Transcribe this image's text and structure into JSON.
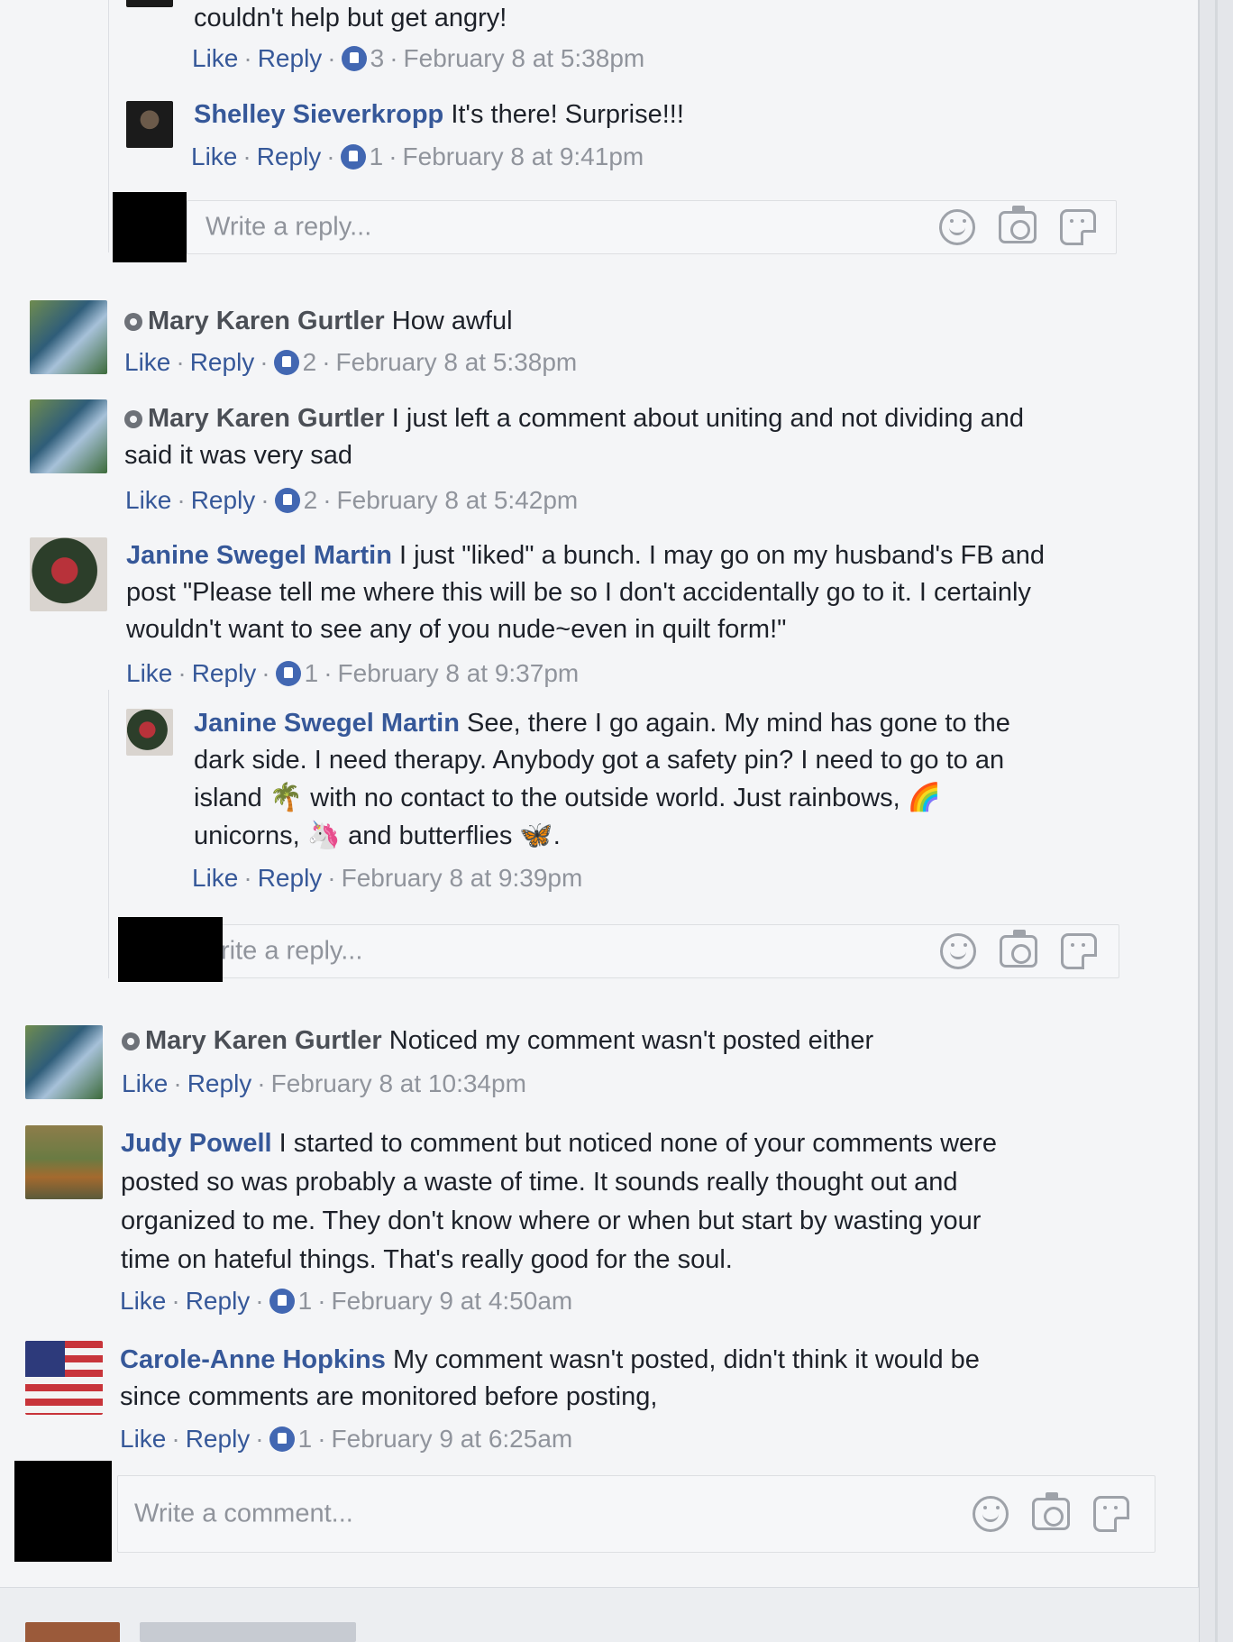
{
  "labels": {
    "like": "Like",
    "reply": "Reply",
    "dot": "·"
  },
  "comments": {
    "c0": {
      "text": "couldn't help but get angry!",
      "likes": "3",
      "time": "February 8 at 5:38pm"
    },
    "c1": {
      "author": "Shelley Sieverkropp",
      "text": "It's there! Surprise!!!",
      "likes": "1",
      "time": "February 8 at 9:41pm"
    },
    "c2": {
      "author": "Mary Karen Gurtler",
      "text": "How awful",
      "likes": "2",
      "time": "February 8 at 5:38pm"
    },
    "c3": {
      "author": "Mary Karen Gurtler",
      "text_line1": "I just left a comment about uniting and not dividing and",
      "text_line2": "said it was very sad",
      "likes": "2",
      "time": "February 8 at 5:42pm"
    },
    "c4": {
      "author": "Janine Swegel Martin",
      "text_line1": "I just \"liked\" a bunch. I may go on my husband's FB and",
      "text_line2": "post \"Please tell me where this will be so I don't accidentally go to it. I certainly",
      "text_line3": "wouldn't want to see any of you nude~even in quilt form!\"",
      "likes": "1",
      "time": "February 8 at 9:37pm"
    },
    "c5": {
      "author": "Janine Swegel Martin",
      "text_line1": "See, there I go again. My mind has gone to the",
      "text_line2": "dark side. I need therapy. Anybody got a safety pin? I need to go to an",
      "text_line3a": "island",
      "text_line3b": "with no contact to the outside world. Just rainbows,",
      "text_line4a": "unicorns,",
      "text_line4b": "and butterflies",
      "text_line4c": ".",
      "time": "February 8 at 9:39pm",
      "emoji_palm": "🌴",
      "emoji_rainbow": "🌈",
      "emoji_unicorn": "🦄",
      "emoji_butterfly": "🦋"
    },
    "c6": {
      "author": "Mary Karen Gurtler",
      "text": "Noticed my comment wasn't posted either",
      "time": "February 8 at 10:34pm"
    },
    "c7": {
      "author": "Judy Powell",
      "text_line1": "I started to comment but noticed none of your comments were",
      "text_line2": "posted so was probably a waste of time. It sounds really thought out and",
      "text_line3": "organized to me. They don't know where or when but start by wasting your",
      "text_line4": "time on hateful things. That's really good for the soul.",
      "likes": "1",
      "time": "February 9 at 4:50am"
    },
    "c8": {
      "author": "Carole-Anne Hopkins",
      "text_line1": "My comment wasn't posted, didn't think it would be",
      "text_line2": "since comments are monitored before posting,",
      "likes": "1",
      "time": "February 9 at 6:25am"
    }
  },
  "inputs": {
    "reply_placeholder": "Write a reply...",
    "reply_placeholder_cut": "rite a reply...",
    "comment_placeholder": "Write a comment..."
  },
  "colors": {
    "link": "#365899",
    "meta": "#90949c",
    "like_blue": "#4267b2"
  },
  "icons": [
    "emoji-icon",
    "camera-icon",
    "sticker-icon",
    "like-reaction-icon"
  ]
}
